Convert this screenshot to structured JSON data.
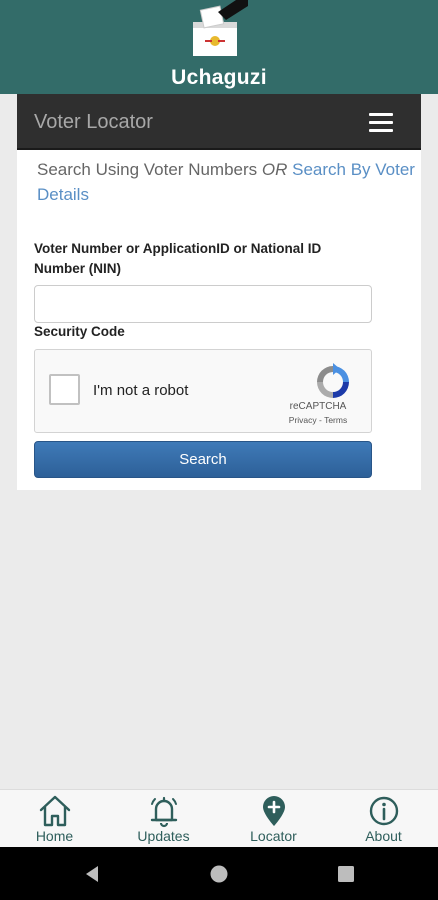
{
  "app": {
    "title": "Uchaguzi",
    "brand_color": "#336c69"
  },
  "navbar": {
    "title": "Voter Locator",
    "menu_icon": "hamburger-menu-icon"
  },
  "search_mode": {
    "prefix": "Search Using Voter Numbers ",
    "or": "OR",
    "link": "Search By Voter Details",
    "link_color": "#5a8fc5"
  },
  "form": {
    "voter_number_label": "Voter Number or ApplicationID or National ID Number (NIN)",
    "voter_number_value": "",
    "security_code_label": "Security Code",
    "search_button": "Search",
    "button_color": "#2d6098"
  },
  "recaptcha": {
    "label": "I'm not a robot",
    "brand": "reCAPTCHA",
    "privacy": "Privacy",
    "separator": " - ",
    "terms": "Terms",
    "checked": false
  },
  "bottom_nav": {
    "items": [
      {
        "label": "Home",
        "icon": "home-icon"
      },
      {
        "label": "Updates",
        "icon": "bell-icon"
      },
      {
        "label": "Locator",
        "icon": "location-pin-icon",
        "active": true
      },
      {
        "label": "About",
        "icon": "info-icon"
      }
    ]
  },
  "system_nav": {
    "buttons": [
      "back-icon",
      "home-circle-icon",
      "recents-icon"
    ]
  }
}
